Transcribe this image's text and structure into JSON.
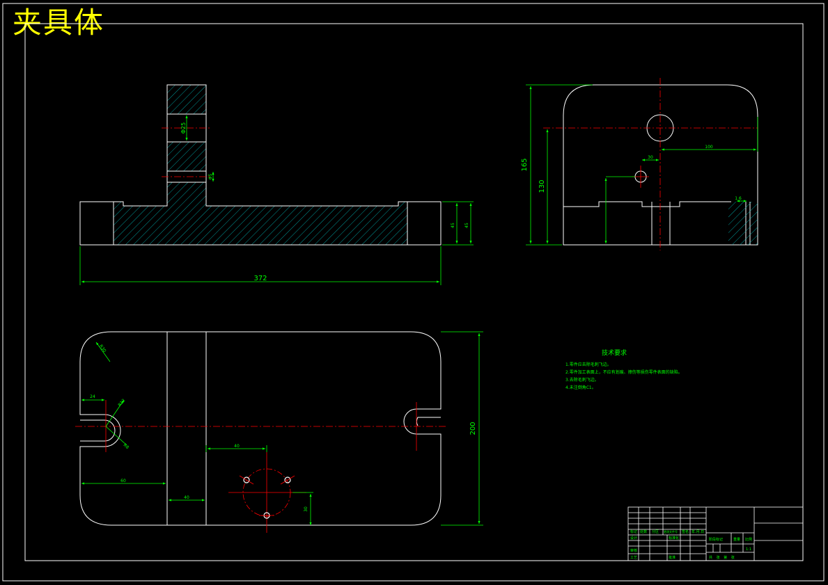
{
  "drawing_title": "夹具体",
  "colors": {
    "background": "#000000",
    "outline": "#ffffff",
    "dimension": "#00ff00",
    "centerline": "#ff0000",
    "hatch": "#00bfbf",
    "title": "#ffff00"
  },
  "dimensions": {
    "overall_length": "372",
    "side_height": "165",
    "side_height_2": "130",
    "plan_width": "200",
    "hole_dia": "Φ25",
    "small_hole_dia": "Φ5",
    "side_offset": "100",
    "hole_offset": "30",
    "plan_x1": "60",
    "plan_x2": "40",
    "plan_x3": "40",
    "slot_width": "24",
    "slot_radius": "R8",
    "slot_radius_2": "R12",
    "corner_radius": "R30",
    "base_height": "45",
    "base_height_2": "45",
    "tab_width": "1.6"
  },
  "technical_requirements": {
    "heading": "技术要求",
    "lines": [
      "1.零件应去除毛刺飞边。",
      "2.零件加工表面上，不应有划痕、擦伤等损伤零件表面的缺陷。",
      "3.去除毛刺飞边。",
      "4.未注倒角C1。"
    ]
  },
  "title_block": {
    "row_labels": [
      "标记",
      "处数",
      "分区",
      "更改文件号",
      "签名",
      "年.月.日"
    ],
    "design": "设计",
    "standardize": "标准化",
    "review": "审核",
    "process": "工艺",
    "approve": "批准",
    "stage_mark": "阶段标记",
    "weight": "重量",
    "scale": "比例",
    "scale_value": "1:1",
    "sheet": "共  张  第  张"
  }
}
